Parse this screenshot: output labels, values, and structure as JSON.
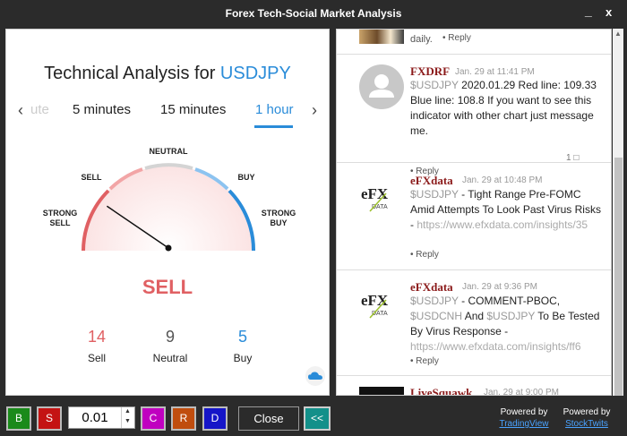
{
  "window": {
    "title": "Forex Tech-Social Market Analysis",
    "min_glyph": "_",
    "close_glyph": "x"
  },
  "analysis": {
    "title_prefix": "Technical Analysis for",
    "symbol": "USDJPY",
    "tabs": [
      "ute",
      "5 minutes",
      "15 minutes",
      "1 hour"
    ],
    "active_tab": "1 hour",
    "gauge_labels": {
      "strong_sell": "STRONG\nSELL",
      "sell": "SELL",
      "neutral": "NEUTRAL",
      "buy": "BUY",
      "strong_buy": "STRONG\nBUY"
    },
    "needle_level": -0.62,
    "verdict": "SELL",
    "counts": [
      {
        "label": "Sell",
        "value": "14"
      },
      {
        "label": "Neutral",
        "value": "9"
      },
      {
        "label": "Buy",
        "value": "5"
      }
    ],
    "colors": {
      "sell": "#e06063",
      "buy": "#2a8cd9",
      "neutral": "#d0d0d0"
    }
  },
  "feed": {
    "top_fragment": "daily.",
    "reply_label": "Reply",
    "posts": [
      {
        "author": "FXDRF",
        "time": "Jan. 29 at 11:41 PM",
        "body_segments": [
          {
            "t": "$USDJPY",
            "k": "tk"
          },
          {
            "t": " 2020.01.29 Red line: 109.33 Blue line: 108.8 If you want to see this indicator with other chart just message me.",
            "k": ""
          }
        ],
        "comment_count": "1"
      },
      {
        "author": "eFXdata",
        "time": "Jan. 29 at 10:48 PM",
        "body_segments": [
          {
            "t": "$USDJPY",
            "k": "tk"
          },
          {
            "t": " - Tight Range Pre-FOMC Amid Attempts To Look Past Virus Risks - ",
            "k": ""
          },
          {
            "t": "https://www.efxdata.com/insights/35",
            "k": "url"
          }
        ]
      },
      {
        "author": "eFXdata",
        "time": "Jan. 29 at 9:36 PM",
        "body_segments": [
          {
            "t": "$USDJPY",
            "k": "tk"
          },
          {
            "t": " - COMMENT-PBOC, ",
            "k": ""
          },
          {
            "t": "$USDCNH",
            "k": "tk"
          },
          {
            "t": " And ",
            "k": ""
          },
          {
            "t": "$USDJPY",
            "k": "tk"
          },
          {
            "t": " To Be Tested By Virus Response - ",
            "k": ""
          },
          {
            "t": "https://www.efxdata.com/insights/ff6",
            "k": "url"
          }
        ]
      },
      {
        "author": "LiveSquawk",
        "time": "Jan. 29 at 9:00 PM"
      }
    ]
  },
  "toolbar": {
    "buy_label": "B",
    "sell_label": "S",
    "lot_value": "0.01",
    "c_label": "C",
    "r_label": "R",
    "d_label": "D",
    "close_label": "Close",
    "collapse_label": "<<",
    "powered_by": "Powered by",
    "tradingview": "TradingView",
    "stocktwits": "StockTwits"
  }
}
